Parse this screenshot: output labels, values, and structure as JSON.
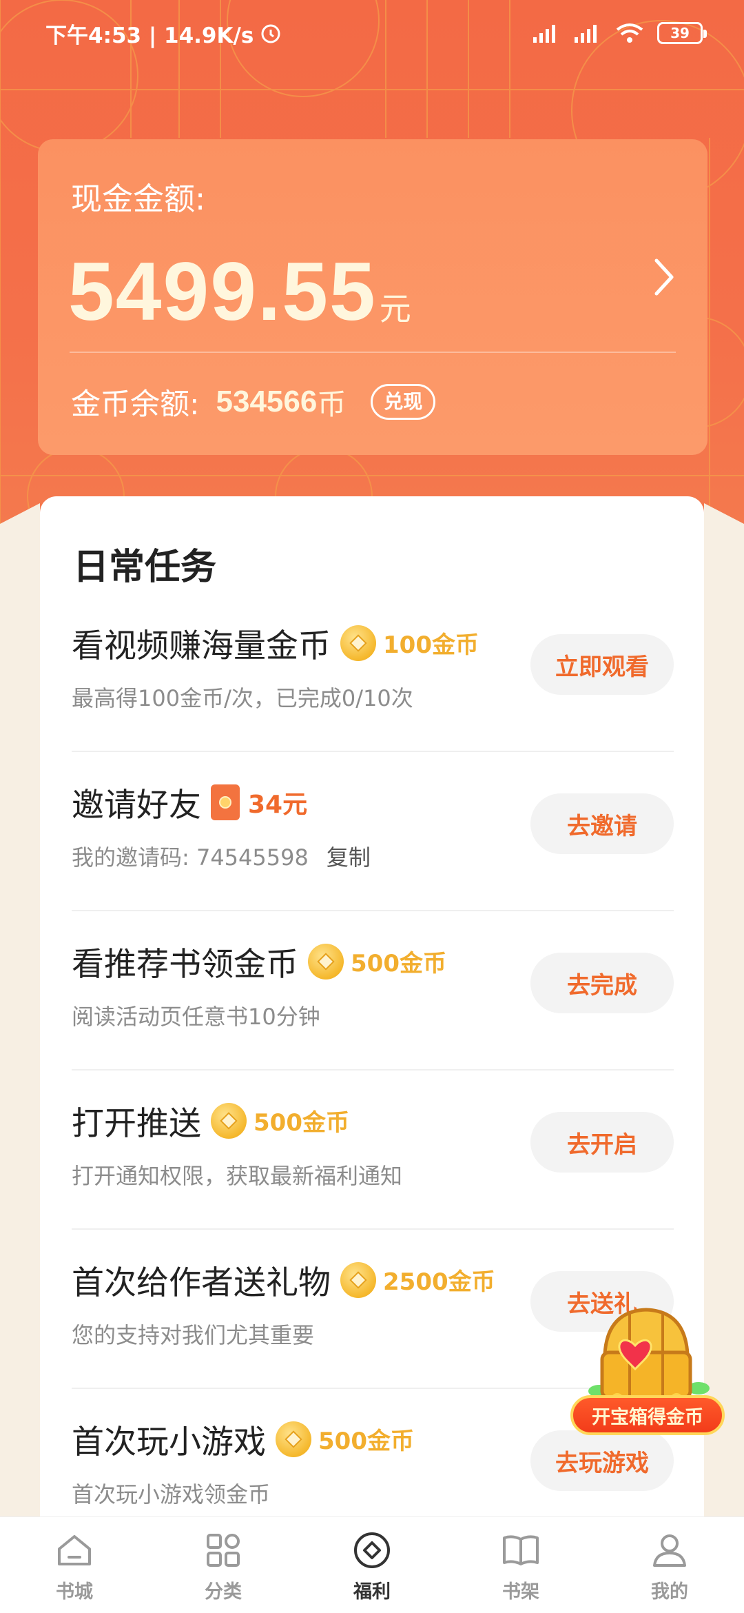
{
  "status_bar": {
    "time_speed": "下午4:53 | 14.9K/s",
    "battery": "39"
  },
  "cash": {
    "label": "现金金额:",
    "amount": "5499.55",
    "unit": "元",
    "coin_label": "金币余额:",
    "coin_value": "534566",
    "coin_unit": "币",
    "exchange_label": "兑现"
  },
  "tasks": {
    "title": "日常任务",
    "items": [
      {
        "name": "看视频赚海量金币",
        "reward": "100金币",
        "reward_type": "coin",
        "desc": "最高得100金币/次，已完成0/10次",
        "button": "立即观看"
      },
      {
        "name": "邀请好友",
        "reward": "34元",
        "reward_type": "cash",
        "desc": "我的邀请码: 74545598",
        "desc_action": "复制",
        "button": "去邀请"
      },
      {
        "name": "看推荐书领金币",
        "reward": "500金币",
        "reward_type": "coin",
        "desc": "阅读活动页任意书10分钟",
        "button": "去完成"
      },
      {
        "name": "打开推送",
        "reward": "500金币",
        "reward_type": "coin",
        "desc": "打开通知权限，获取最新福利通知",
        "button": "去开启"
      },
      {
        "name": "首次给作者送礼物",
        "reward": "2500金币",
        "reward_type": "coin",
        "desc": "您的支持对我们尤其重要",
        "button": "去送礼"
      },
      {
        "name": "首次玩小游戏",
        "reward": "500金币",
        "reward_type": "coin",
        "desc": "首次玩小游戏领金币",
        "button": "去玩游戏"
      }
    ]
  },
  "chest": {
    "label": "开宝箱得金币"
  },
  "nav": {
    "items": [
      {
        "label": "书城",
        "icon": "home-icon"
      },
      {
        "label": "分类",
        "icon": "grid-icon"
      },
      {
        "label": "福利",
        "icon": "coin-icon",
        "active": true
      },
      {
        "label": "书架",
        "icon": "book-icon"
      },
      {
        "label": "我的",
        "icon": "user-icon"
      }
    ]
  },
  "colors": {
    "accent": "#f06a2c",
    "header_bg": "#f36a45",
    "card_bg": "#fb9161",
    "reward_gold": "#f2ae2e",
    "page_bg": "#f7efe3"
  }
}
